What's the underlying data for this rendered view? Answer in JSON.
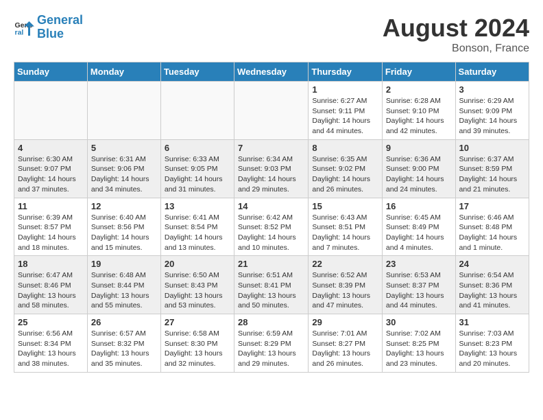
{
  "header": {
    "logo_line1": "General",
    "logo_line2": "Blue",
    "month_year": "August 2024",
    "location": "Bonson, France"
  },
  "weekdays": [
    "Sunday",
    "Monday",
    "Tuesday",
    "Wednesday",
    "Thursday",
    "Friday",
    "Saturday"
  ],
  "weeks": [
    [
      {
        "day": "",
        "info": ""
      },
      {
        "day": "",
        "info": ""
      },
      {
        "day": "",
        "info": ""
      },
      {
        "day": "",
        "info": ""
      },
      {
        "day": "1",
        "info": "Sunrise: 6:27 AM\nSunset: 9:11 PM\nDaylight: 14 hours\nand 44 minutes."
      },
      {
        "day": "2",
        "info": "Sunrise: 6:28 AM\nSunset: 9:10 PM\nDaylight: 14 hours\nand 42 minutes."
      },
      {
        "day": "3",
        "info": "Sunrise: 6:29 AM\nSunset: 9:09 PM\nDaylight: 14 hours\nand 39 minutes."
      }
    ],
    [
      {
        "day": "4",
        "info": "Sunrise: 6:30 AM\nSunset: 9:07 PM\nDaylight: 14 hours\nand 37 minutes."
      },
      {
        "day": "5",
        "info": "Sunrise: 6:31 AM\nSunset: 9:06 PM\nDaylight: 14 hours\nand 34 minutes."
      },
      {
        "day": "6",
        "info": "Sunrise: 6:33 AM\nSunset: 9:05 PM\nDaylight: 14 hours\nand 31 minutes."
      },
      {
        "day": "7",
        "info": "Sunrise: 6:34 AM\nSunset: 9:03 PM\nDaylight: 14 hours\nand 29 minutes."
      },
      {
        "day": "8",
        "info": "Sunrise: 6:35 AM\nSunset: 9:02 PM\nDaylight: 14 hours\nand 26 minutes."
      },
      {
        "day": "9",
        "info": "Sunrise: 6:36 AM\nSunset: 9:00 PM\nDaylight: 14 hours\nand 24 minutes."
      },
      {
        "day": "10",
        "info": "Sunrise: 6:37 AM\nSunset: 8:59 PM\nDaylight: 14 hours\nand 21 minutes."
      }
    ],
    [
      {
        "day": "11",
        "info": "Sunrise: 6:39 AM\nSunset: 8:57 PM\nDaylight: 14 hours\nand 18 minutes."
      },
      {
        "day": "12",
        "info": "Sunrise: 6:40 AM\nSunset: 8:56 PM\nDaylight: 14 hours\nand 15 minutes."
      },
      {
        "day": "13",
        "info": "Sunrise: 6:41 AM\nSunset: 8:54 PM\nDaylight: 14 hours\nand 13 minutes."
      },
      {
        "day": "14",
        "info": "Sunrise: 6:42 AM\nSunset: 8:52 PM\nDaylight: 14 hours\nand 10 minutes."
      },
      {
        "day": "15",
        "info": "Sunrise: 6:43 AM\nSunset: 8:51 PM\nDaylight: 14 hours\nand 7 minutes."
      },
      {
        "day": "16",
        "info": "Sunrise: 6:45 AM\nSunset: 8:49 PM\nDaylight: 14 hours\nand 4 minutes."
      },
      {
        "day": "17",
        "info": "Sunrise: 6:46 AM\nSunset: 8:48 PM\nDaylight: 14 hours\nand 1 minute."
      }
    ],
    [
      {
        "day": "18",
        "info": "Sunrise: 6:47 AM\nSunset: 8:46 PM\nDaylight: 13 hours\nand 58 minutes."
      },
      {
        "day": "19",
        "info": "Sunrise: 6:48 AM\nSunset: 8:44 PM\nDaylight: 13 hours\nand 55 minutes."
      },
      {
        "day": "20",
        "info": "Sunrise: 6:50 AM\nSunset: 8:43 PM\nDaylight: 13 hours\nand 53 minutes."
      },
      {
        "day": "21",
        "info": "Sunrise: 6:51 AM\nSunset: 8:41 PM\nDaylight: 13 hours\nand 50 minutes."
      },
      {
        "day": "22",
        "info": "Sunrise: 6:52 AM\nSunset: 8:39 PM\nDaylight: 13 hours\nand 47 minutes."
      },
      {
        "day": "23",
        "info": "Sunrise: 6:53 AM\nSunset: 8:37 PM\nDaylight: 13 hours\nand 44 minutes."
      },
      {
        "day": "24",
        "info": "Sunrise: 6:54 AM\nSunset: 8:36 PM\nDaylight: 13 hours\nand 41 minutes."
      }
    ],
    [
      {
        "day": "25",
        "info": "Sunrise: 6:56 AM\nSunset: 8:34 PM\nDaylight: 13 hours\nand 38 minutes."
      },
      {
        "day": "26",
        "info": "Sunrise: 6:57 AM\nSunset: 8:32 PM\nDaylight: 13 hours\nand 35 minutes."
      },
      {
        "day": "27",
        "info": "Sunrise: 6:58 AM\nSunset: 8:30 PM\nDaylight: 13 hours\nand 32 minutes."
      },
      {
        "day": "28",
        "info": "Sunrise: 6:59 AM\nSunset: 8:29 PM\nDaylight: 13 hours\nand 29 minutes."
      },
      {
        "day": "29",
        "info": "Sunrise: 7:01 AM\nSunset: 8:27 PM\nDaylight: 13 hours\nand 26 minutes."
      },
      {
        "day": "30",
        "info": "Sunrise: 7:02 AM\nSunset: 8:25 PM\nDaylight: 13 hours\nand 23 minutes."
      },
      {
        "day": "31",
        "info": "Sunrise: 7:03 AM\nSunset: 8:23 PM\nDaylight: 13 hours\nand 20 minutes."
      }
    ]
  ]
}
